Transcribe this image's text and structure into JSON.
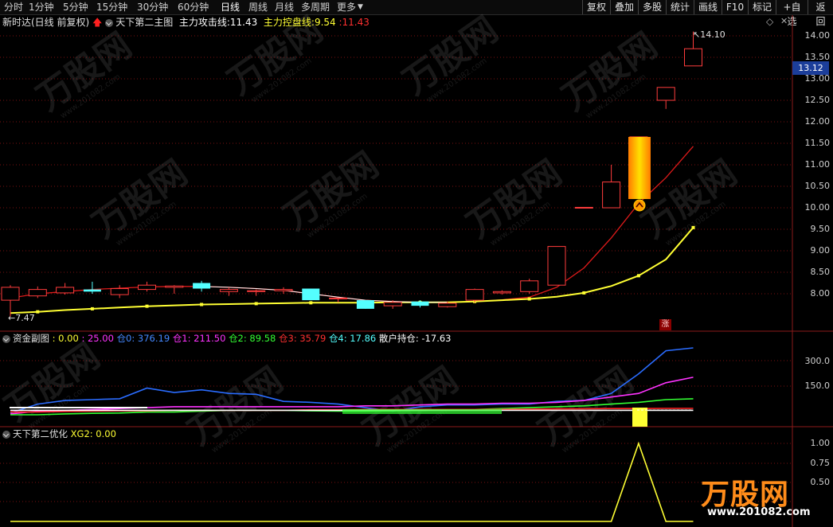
{
  "toolbar": {
    "periods": [
      "分时",
      "1分钟",
      "5分钟",
      "15分钟",
      "30分钟",
      "60分钟",
      "日线",
      "周线",
      "月线",
      "多周期",
      "更多"
    ],
    "active_period": "日线",
    "more_arrow": "▼",
    "right_buttons": [
      "复权",
      "叠加",
      "多股",
      "统计",
      "画线",
      "F10",
      "标记",
      "+自选",
      "返回"
    ]
  },
  "main_panel": {
    "stock_title": "新时达(日线 前复权)",
    "indicator_name": "天下第二主图",
    "attack_line_label": "主力攻击线:",
    "attack_line_value": "11.43",
    "control_line_label": "主力控盘线:",
    "control_line_value": "9.54",
    "extra_value": "11.43",
    "price_axis": [
      "14.00",
      "13.50",
      "13.00",
      "12.50",
      "12.00",
      "11.50",
      "11.00",
      "10.50",
      "10.00",
      "9.50",
      "9.00",
      "8.50",
      "8.00"
    ],
    "current_price": "13.12",
    "high_marker": "14.10",
    "low_marker": "7.47",
    "zhang_badge": "涨"
  },
  "fund_panel": {
    "name": "资金副图",
    "v0_label": ": 0.00",
    "v1_label": ": 25.00",
    "cang0": "仓0: 376.19",
    "cang1": "仓1: 211.50",
    "cang2": "仓2: 89.58",
    "cang3": "仓3: 35.79",
    "cang4": "仓4: 17.86",
    "retail": "散户持仓: -17.63",
    "axis": [
      "300.0",
      "150.0"
    ]
  },
  "opt_panel": {
    "name": "天下第二优化",
    "xg2": "XG2: 0.00",
    "axis": [
      "1.00",
      "0.75",
      "0.50"
    ]
  },
  "watermark": {
    "brand": "万股网",
    "url": "www.201082.com"
  },
  "colors": {
    "up": "#ff3c3c",
    "down": "#54ffff",
    "yellow": "#ffff33",
    "blue": "#2a6cff",
    "magenta": "#ff33ff",
    "green": "#33ff33",
    "red": "#ff2020",
    "white": "#ffffff"
  },
  "chart_data": {
    "type": "candlestick",
    "price_range": [
      7.4,
      14.4
    ],
    "candles": [
      {
        "o": 7.85,
        "c": 8.15,
        "h": 8.2,
        "l": 7.47
      },
      {
        "o": 7.95,
        "c": 8.1,
        "h": 8.17,
        "l": 7.9
      },
      {
        "o": 8.02,
        "c": 8.15,
        "h": 8.25,
        "l": 7.98
      },
      {
        "o": 8.1,
        "c": 8.05,
        "h": 8.28,
        "l": 8.0
      },
      {
        "o": 7.98,
        "c": 8.12,
        "h": 8.2,
        "l": 7.9
      },
      {
        "o": 8.1,
        "c": 8.2,
        "h": 8.28,
        "l": 8.05
      },
      {
        "o": 8.15,
        "c": 8.18,
        "h": 8.2,
        "l": 8.0
      },
      {
        "o": 8.25,
        "c": 8.12,
        "h": 8.3,
        "l": 8.05
      },
      {
        "o": 8.05,
        "c": 8.1,
        "h": 8.15,
        "l": 7.95
      },
      {
        "o": 8.05,
        "c": 8.07,
        "h": 8.1,
        "l": 7.95
      },
      {
        "o": 8.07,
        "c": 8.1,
        "h": 8.15,
        "l": 8.0
      },
      {
        "o": 8.12,
        "c": 7.85,
        "h": 8.12,
        "l": 7.85
      },
      {
        "o": 7.9,
        "c": 7.9,
        "h": 7.9,
        "l": 7.8
      },
      {
        "o": 7.85,
        "c": 7.65,
        "h": 7.85,
        "l": 7.65
      },
      {
        "o": 7.72,
        "c": 7.8,
        "h": 7.85,
        "l": 7.65
      },
      {
        "o": 7.82,
        "c": 7.72,
        "h": 7.85,
        "l": 7.68
      },
      {
        "o": 7.7,
        "c": 7.78,
        "h": 7.82,
        "l": 7.68
      },
      {
        "o": 7.85,
        "c": 8.1,
        "h": 8.12,
        "l": 7.8
      },
      {
        "o": 8.02,
        "c": 8.05,
        "h": 8.08,
        "l": 7.98
      },
      {
        "o": 8.05,
        "c": 8.3,
        "h": 8.35,
        "l": 8.0
      },
      {
        "o": 8.2,
        "c": 9.1,
        "h": 9.1,
        "l": 8.2
      },
      {
        "o": 10.0,
        "c": 10.01,
        "h": 10.01,
        "l": 10.0
      },
      {
        "o": 10.0,
        "c": 10.6,
        "h": 11.0,
        "l": 10.0
      },
      {
        "o": 10.6,
        "c": 11.65,
        "h": 11.65,
        "l": 10.6
      },
      {
        "o": 12.5,
        "c": 12.8,
        "h": 12.8,
        "l": 12.3
      },
      {
        "o": 13.3,
        "c": 13.7,
        "h": 14.1,
        "l": 13.3
      }
    ],
    "control_line": [
      7.55,
      7.58,
      7.62,
      7.65,
      7.68,
      7.71,
      7.73,
      7.75,
      7.76,
      7.77,
      7.78,
      7.79,
      7.79,
      7.79,
      7.8,
      7.8,
      7.8,
      7.82,
      7.85,
      7.88,
      7.93,
      8.02,
      8.18,
      8.42,
      8.8,
      9.54
    ],
    "attack_line": [
      7.9,
      8.0,
      8.05,
      8.1,
      8.13,
      8.16,
      8.17,
      8.17,
      8.15,
      8.12,
      8.08,
      8.0,
      7.92,
      7.85,
      7.82,
      7.8,
      7.8,
      7.82,
      7.86,
      7.92,
      8.15,
      8.6,
      9.3,
      10.1,
      10.7,
      11.43
    ],
    "fund_series": [
      {
        "color": "blue",
        "values": [
          10,
          60,
          80,
          85,
          90,
          150,
          125,
          140,
          120,
          115,
          75,
          70,
          60,
          40,
          20,
          45,
          55,
          55,
          60,
          60,
          75,
          80,
          120,
          230,
          360,
          376
        ]
      },
      {
        "color": "magenta",
        "values": [
          5,
          20,
          25,
          30,
          35,
          40,
          45,
          45,
          45,
          45,
          45,
          45,
          45,
          50,
          50,
          55,
          60,
          60,
          65,
          65,
          70,
          80,
          100,
          120,
          180,
          211
        ]
      },
      {
        "color": "green",
        "values": [
          0,
          0,
          5,
          8,
          10,
          15,
          15,
          20,
          25,
          25,
          25,
          22,
          20,
          20,
          22,
          25,
          28,
          30,
          35,
          40,
          45,
          50,
          60,
          70,
          85,
          90
        ]
      },
      {
        "color": "red",
        "values": [
          15,
          15,
          18,
          20,
          22,
          22,
          25,
          25,
          25,
          25,
          25,
          28,
          28,
          30,
          30,
          30,
          30,
          30,
          30,
          32,
          33,
          34,
          35,
          35,
          36,
          36
        ]
      },
      {
        "color": "white",
        "values": [
          25,
          25,
          25,
          25,
          25,
          25,
          25,
          25,
          25,
          25,
          25,
          25,
          25,
          25,
          25,
          25,
          25,
          25,
          25,
          25,
          25,
          25,
          25,
          25,
          25,
          25
        ]
      }
    ],
    "xg2": [
      0,
      0,
      0,
      0,
      0,
      0,
      0,
      0,
      0,
      0,
      0,
      0,
      0,
      0,
      0,
      0,
      0,
      0,
      0,
      0,
      0,
      0,
      0,
      1,
      0,
      0
    ]
  }
}
